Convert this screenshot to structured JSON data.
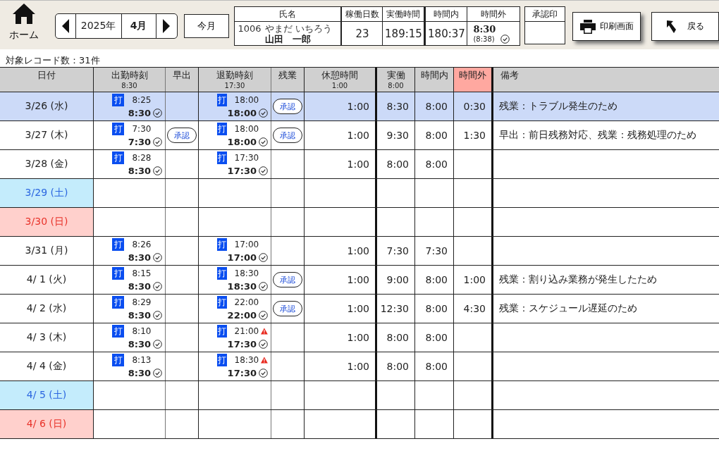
{
  "home": {
    "label": "ホーム"
  },
  "month_nav": {
    "year": "2025年",
    "month": "4月"
  },
  "this_month_button": "今月",
  "summary": {
    "name_header": "氏名",
    "employee_id": "1006",
    "kana": "やまだ いちろう",
    "name": "山田　一郎",
    "columns": [
      {
        "header": "稼働日数",
        "value": "23"
      },
      {
        "header": "実働時間",
        "value": "189:15"
      },
      {
        "header": "時間内",
        "value": "180:37"
      }
    ],
    "overtime": {
      "header": "時間外",
      "value": "8:30",
      "sub": "(8:38)",
      "confirmed": true
    },
    "stamp_header": "承認印"
  },
  "print_button": "印刷画面",
  "back_button": "戻る",
  "record_count": "対象レコード数：31件",
  "table": {
    "columns": [
      {
        "label": "日付"
      },
      {
        "label": "出勤時刻",
        "sub": "8:30"
      },
      {
        "label": "早出"
      },
      {
        "label": "退勤時刻",
        "sub": "17:30"
      },
      {
        "label": "残業"
      },
      {
        "label": "休憩時間",
        "sub": "1:00"
      },
      {
        "label": "実働",
        "sub": "8:00"
      },
      {
        "label": "時間内"
      },
      {
        "label": "時間外",
        "highlight": true
      },
      {
        "label": "備考"
      }
    ],
    "rows": [
      {
        "date": "3/26 (水)",
        "kind": "weekday",
        "selected": true,
        "clock_in": {
          "mark": "打",
          "punch": "8:25",
          "rounded": "8:30",
          "confirmed": true
        },
        "early": "",
        "clock_out": {
          "mark": "打",
          "punch": "18:00",
          "rounded": "18:00",
          "confirmed": true,
          "warning": false
        },
        "overtime": "承認",
        "break": "1:00",
        "actual": "8:30",
        "within": "8:00",
        "over": "0:30",
        "note": "残業：トラブル発生のため"
      },
      {
        "date": "3/27 (木)",
        "kind": "weekday",
        "selected": false,
        "clock_in": {
          "mark": "打",
          "punch": "7:30",
          "rounded": "7:30",
          "confirmed": true
        },
        "early": "承認",
        "clock_out": {
          "mark": "打",
          "punch": "18:00",
          "rounded": "18:00",
          "confirmed": true,
          "warning": false
        },
        "overtime": "承認",
        "break": "1:00",
        "actual": "9:30",
        "within": "8:00",
        "over": "1:30",
        "note": "早出：前日残務対応、残業：残務処理のため"
      },
      {
        "date": "3/28 (金)",
        "kind": "weekday",
        "selected": false,
        "clock_in": {
          "mark": "打",
          "punch": "8:28",
          "rounded": "8:30",
          "confirmed": true
        },
        "early": "",
        "clock_out": {
          "mark": "打",
          "punch": "17:30",
          "rounded": "17:30",
          "confirmed": true,
          "warning": false
        },
        "overtime": "",
        "break": "1:00",
        "actual": "8:00",
        "within": "8:00",
        "over": "",
        "note": ""
      },
      {
        "date": "3/29 (土)",
        "kind": "saturday",
        "selected": false
      },
      {
        "date": "3/30 (日)",
        "kind": "sunday",
        "selected": false
      },
      {
        "date": "3/31 (月)",
        "kind": "weekday",
        "selected": false,
        "clock_in": {
          "mark": "打",
          "punch": "8:26",
          "rounded": "8:30",
          "confirmed": true
        },
        "early": "",
        "clock_out": {
          "mark": "打",
          "punch": "17:00",
          "rounded": "17:00",
          "confirmed": true,
          "warning": false
        },
        "overtime": "",
        "break": "1:00",
        "actual": "7:30",
        "within": "7:30",
        "over": "",
        "note": ""
      },
      {
        "date": "4/ 1 (火)",
        "kind": "weekday",
        "selected": false,
        "clock_in": {
          "mark": "打",
          "punch": "8:15",
          "rounded": "8:30",
          "confirmed": true
        },
        "early": "",
        "clock_out": {
          "mark": "打",
          "punch": "18:30",
          "rounded": "18:30",
          "confirmed": true,
          "warning": false
        },
        "overtime": "承認",
        "break": "1:00",
        "actual": "9:00",
        "within": "8:00",
        "over": "1:00",
        "note": "残業：割り込み業務が発生したため"
      },
      {
        "date": "4/ 2 (水)",
        "kind": "weekday",
        "selected": false,
        "clock_in": {
          "mark": "打",
          "punch": "8:29",
          "rounded": "8:30",
          "confirmed": true
        },
        "early": "",
        "clock_out": {
          "mark": "打",
          "punch": "22:00",
          "rounded": "22:00",
          "confirmed": true,
          "warning": false
        },
        "overtime": "承認",
        "break": "1:00",
        "actual": "12:30",
        "within": "8:00",
        "over": "4:30",
        "note": "残業：スケジュール遅延のため"
      },
      {
        "date": "4/ 3 (木)",
        "kind": "weekday",
        "selected": false,
        "clock_in": {
          "mark": "打",
          "punch": "8:10",
          "rounded": "8:30",
          "confirmed": true
        },
        "early": "",
        "clock_out": {
          "mark": "打",
          "punch": "21:00",
          "rounded": "17:30",
          "confirmed": true,
          "warning": true
        },
        "overtime": "",
        "break": "1:00",
        "actual": "8:00",
        "within": "8:00",
        "over": "",
        "note": ""
      },
      {
        "date": "4/ 4 (金)",
        "kind": "weekday",
        "selected": false,
        "clock_in": {
          "mark": "打",
          "punch": "8:13",
          "rounded": "8:30",
          "confirmed": true
        },
        "early": "",
        "clock_out": {
          "mark": "打",
          "punch": "18:30",
          "rounded": "17:30",
          "confirmed": true,
          "warning": true
        },
        "overtime": "",
        "break": "1:00",
        "actual": "8:00",
        "within": "8:00",
        "over": "",
        "note": ""
      },
      {
        "date": "4/ 5 (土)",
        "kind": "saturday",
        "selected": false
      },
      {
        "date": "4/ 6 (日)",
        "kind": "sunday",
        "selected": false
      }
    ]
  }
}
